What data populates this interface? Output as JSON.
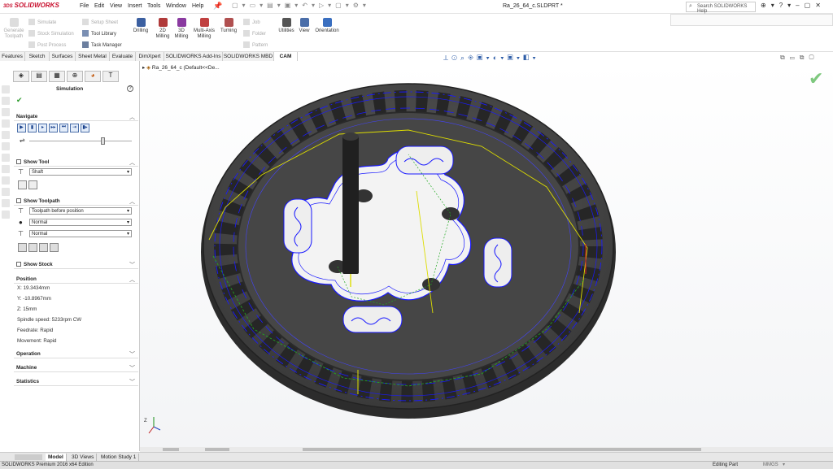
{
  "app": {
    "brand_prefix": "3DS",
    "brand": "SOLIDWORKS",
    "doc_title": "Ra_26_64_c.SLDPRT *",
    "help_search": "Search SOLIDWORKS Help"
  },
  "menu": [
    "File",
    "Edit",
    "View",
    "Insert",
    "Tools",
    "Window",
    "Help"
  ],
  "ribbon": {
    "generate": "Generate Toolpath",
    "simulate": "Simulate",
    "stock_sim": "Stock Simulation",
    "post_process": "Post Process",
    "setup_sheet": "Setup Sheet",
    "tool_library": "Tool Library",
    "task_manager": "Task Manager",
    "drilling": "Drilling",
    "milling2d": "2D Milling",
    "milling3d": "3D Milling",
    "multiaxis": "Multi-Axis Milling",
    "turning": "Turning",
    "job": "Job",
    "folder": "Folder",
    "pattern": "Pattern",
    "utilities": "Utilities",
    "view": "View",
    "orientation": "Orientation"
  },
  "tabs": [
    "Features",
    "Sketch",
    "Surfaces",
    "Sheet Metal",
    "Evaluate",
    "DimXpert",
    "SOLIDWORKS Add-Ins",
    "SOLIDWORKS MBD",
    "CAM"
  ],
  "active_tab": "CAM",
  "tree": {
    "item": "Ra_26_64_c (Default<<De..."
  },
  "panel": {
    "title": "Simulation",
    "navigate": "Navigate",
    "show_tool": "Show Tool",
    "tool_mode": "Shaft",
    "show_toolpath": "Show Toolpath",
    "toolpath_mode": "Toolpath before position",
    "display1": "Normal",
    "display2": "Normal",
    "show_stock": "Show Stock",
    "position": "Position",
    "x": "X: 19.3434mm",
    "y": "Y: -10.8967mm",
    "z": "Z: 15mm",
    "spindle": "Spindle speed: 5233rpm CW",
    "feedrate": "Feedrate: Rapid",
    "movement": "Movement: Rapid",
    "operation": "Operation",
    "machine": "Machine",
    "statistics": "Statistics"
  },
  "bottom_tabs": [
    "Model",
    "3D Views",
    "Motion Study 1"
  ],
  "status": {
    "edition": "SOLIDWORKS Premium 2016 x64 Edition",
    "mode": "Editing Part",
    "units": "MMGS"
  },
  "colors": {
    "toolpath": "#1a1aff",
    "rapid": "#e6e600",
    "link": "#22aa22",
    "part": "#4a4a4a",
    "accept": "#7ec87e"
  }
}
